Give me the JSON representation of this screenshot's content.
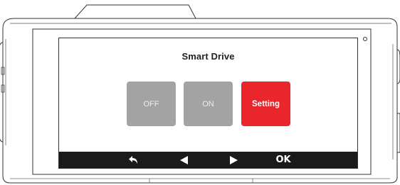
{
  "screen": {
    "title": "Smart Drive"
  },
  "options": {
    "off_label": "OFF",
    "on_label": "ON",
    "setting_label": "Setting",
    "selected": "Setting"
  },
  "bottom_bar": {
    "back_icon": "back-arrow-icon",
    "prev_icon": "triangle-left-icon",
    "next_icon": "triangle-right-icon",
    "ok_label": "OK"
  },
  "colors": {
    "selected": "#e8262b",
    "unselected": "#a3a3a3",
    "bar": "#1a1a1a"
  }
}
